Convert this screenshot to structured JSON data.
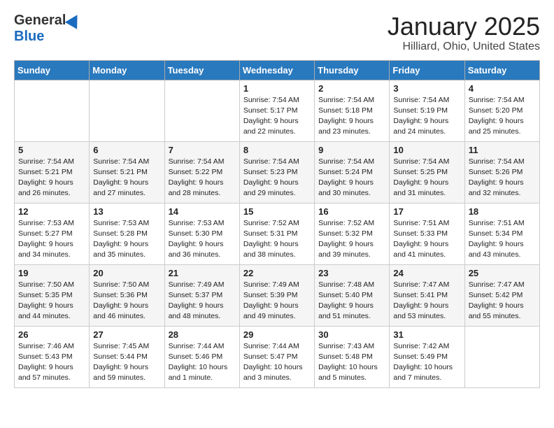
{
  "header": {
    "logo_general": "General",
    "logo_blue": "Blue",
    "month": "January 2025",
    "location": "Hilliard, Ohio, United States"
  },
  "weekdays": [
    "Sunday",
    "Monday",
    "Tuesday",
    "Wednesday",
    "Thursday",
    "Friday",
    "Saturday"
  ],
  "weeks": [
    [
      {
        "day": "",
        "info": ""
      },
      {
        "day": "",
        "info": ""
      },
      {
        "day": "",
        "info": ""
      },
      {
        "day": "1",
        "info": "Sunrise: 7:54 AM\nSunset: 5:17 PM\nDaylight: 9 hours\nand 22 minutes."
      },
      {
        "day": "2",
        "info": "Sunrise: 7:54 AM\nSunset: 5:18 PM\nDaylight: 9 hours\nand 23 minutes."
      },
      {
        "day": "3",
        "info": "Sunrise: 7:54 AM\nSunset: 5:19 PM\nDaylight: 9 hours\nand 24 minutes."
      },
      {
        "day": "4",
        "info": "Sunrise: 7:54 AM\nSunset: 5:20 PM\nDaylight: 9 hours\nand 25 minutes."
      }
    ],
    [
      {
        "day": "5",
        "info": "Sunrise: 7:54 AM\nSunset: 5:21 PM\nDaylight: 9 hours\nand 26 minutes."
      },
      {
        "day": "6",
        "info": "Sunrise: 7:54 AM\nSunset: 5:21 PM\nDaylight: 9 hours\nand 27 minutes."
      },
      {
        "day": "7",
        "info": "Sunrise: 7:54 AM\nSunset: 5:22 PM\nDaylight: 9 hours\nand 28 minutes."
      },
      {
        "day": "8",
        "info": "Sunrise: 7:54 AM\nSunset: 5:23 PM\nDaylight: 9 hours\nand 29 minutes."
      },
      {
        "day": "9",
        "info": "Sunrise: 7:54 AM\nSunset: 5:24 PM\nDaylight: 9 hours\nand 30 minutes."
      },
      {
        "day": "10",
        "info": "Sunrise: 7:54 AM\nSunset: 5:25 PM\nDaylight: 9 hours\nand 31 minutes."
      },
      {
        "day": "11",
        "info": "Sunrise: 7:54 AM\nSunset: 5:26 PM\nDaylight: 9 hours\nand 32 minutes."
      }
    ],
    [
      {
        "day": "12",
        "info": "Sunrise: 7:53 AM\nSunset: 5:27 PM\nDaylight: 9 hours\nand 34 minutes."
      },
      {
        "day": "13",
        "info": "Sunrise: 7:53 AM\nSunset: 5:28 PM\nDaylight: 9 hours\nand 35 minutes."
      },
      {
        "day": "14",
        "info": "Sunrise: 7:53 AM\nSunset: 5:30 PM\nDaylight: 9 hours\nand 36 minutes."
      },
      {
        "day": "15",
        "info": "Sunrise: 7:52 AM\nSunset: 5:31 PM\nDaylight: 9 hours\nand 38 minutes."
      },
      {
        "day": "16",
        "info": "Sunrise: 7:52 AM\nSunset: 5:32 PM\nDaylight: 9 hours\nand 39 minutes."
      },
      {
        "day": "17",
        "info": "Sunrise: 7:51 AM\nSunset: 5:33 PM\nDaylight: 9 hours\nand 41 minutes."
      },
      {
        "day": "18",
        "info": "Sunrise: 7:51 AM\nSunset: 5:34 PM\nDaylight: 9 hours\nand 43 minutes."
      }
    ],
    [
      {
        "day": "19",
        "info": "Sunrise: 7:50 AM\nSunset: 5:35 PM\nDaylight: 9 hours\nand 44 minutes."
      },
      {
        "day": "20",
        "info": "Sunrise: 7:50 AM\nSunset: 5:36 PM\nDaylight: 9 hours\nand 46 minutes."
      },
      {
        "day": "21",
        "info": "Sunrise: 7:49 AM\nSunset: 5:37 PM\nDaylight: 9 hours\nand 48 minutes."
      },
      {
        "day": "22",
        "info": "Sunrise: 7:49 AM\nSunset: 5:39 PM\nDaylight: 9 hours\nand 49 minutes."
      },
      {
        "day": "23",
        "info": "Sunrise: 7:48 AM\nSunset: 5:40 PM\nDaylight: 9 hours\nand 51 minutes."
      },
      {
        "day": "24",
        "info": "Sunrise: 7:47 AM\nSunset: 5:41 PM\nDaylight: 9 hours\nand 53 minutes."
      },
      {
        "day": "25",
        "info": "Sunrise: 7:47 AM\nSunset: 5:42 PM\nDaylight: 9 hours\nand 55 minutes."
      }
    ],
    [
      {
        "day": "26",
        "info": "Sunrise: 7:46 AM\nSunset: 5:43 PM\nDaylight: 9 hours\nand 57 minutes."
      },
      {
        "day": "27",
        "info": "Sunrise: 7:45 AM\nSunset: 5:44 PM\nDaylight: 9 hours\nand 59 minutes."
      },
      {
        "day": "28",
        "info": "Sunrise: 7:44 AM\nSunset: 5:46 PM\nDaylight: 10 hours\nand 1 minute."
      },
      {
        "day": "29",
        "info": "Sunrise: 7:44 AM\nSunset: 5:47 PM\nDaylight: 10 hours\nand 3 minutes."
      },
      {
        "day": "30",
        "info": "Sunrise: 7:43 AM\nSunset: 5:48 PM\nDaylight: 10 hours\nand 5 minutes."
      },
      {
        "day": "31",
        "info": "Sunrise: 7:42 AM\nSunset: 5:49 PM\nDaylight: 10 hours\nand 7 minutes."
      },
      {
        "day": "",
        "info": ""
      }
    ]
  ]
}
